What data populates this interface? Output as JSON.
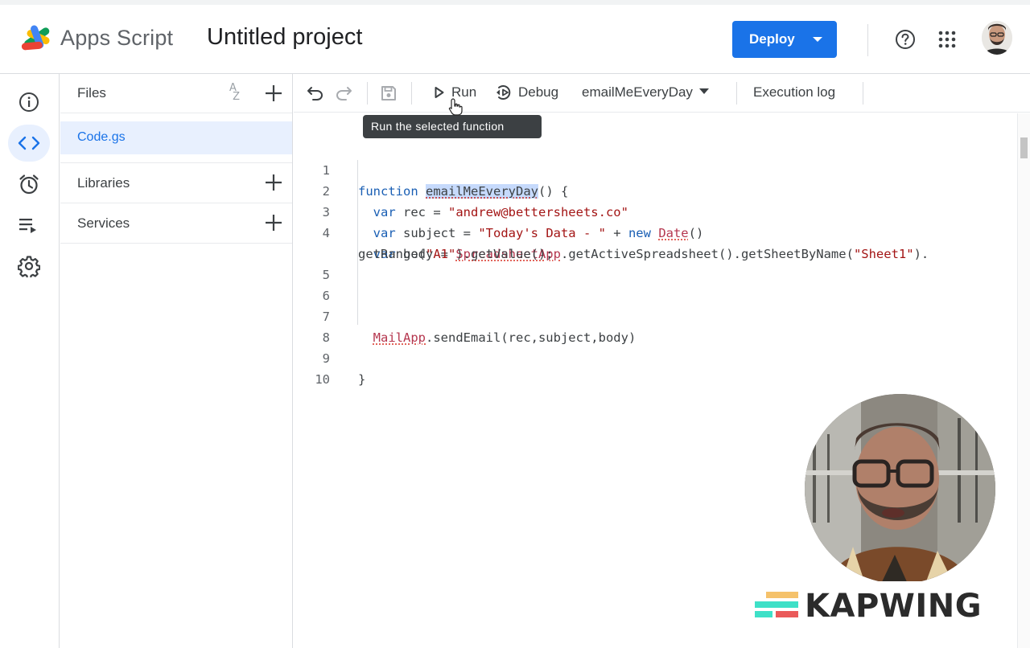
{
  "header": {
    "app_name": "Apps Script",
    "project_title": "Untitled project",
    "deploy_label": "Deploy"
  },
  "rail": {
    "items": [
      "overview",
      "editor",
      "triggers",
      "executions",
      "settings"
    ],
    "active": "editor"
  },
  "files": {
    "title": "Files",
    "items": [
      {
        "name": "Code.gs",
        "selected": true
      }
    ],
    "libraries_label": "Libraries",
    "services_label": "Services"
  },
  "toolbar": {
    "run_label": "Run",
    "debug_label": "Debug",
    "function_name": "emailMeEveryDay",
    "execution_log_label": "Execution log",
    "tooltip": "Run the selected function"
  },
  "editor": {
    "line_numbers": [
      "1",
      "2",
      "3",
      "4",
      "5",
      "6",
      "7",
      "8",
      "9",
      "10"
    ],
    "lines": [
      "function emailMeEveryDay() {",
      "  var rec = \"andrew@bettersheets.co\"",
      "  var subject = \"Today's Data - \" + new Date()",
      "  var body = SpreadsheetApp.getActiveSpreadsheet().getSheetByName(\"Sheet1\").",
      "getRange(\"A1\").getValue();",
      "",
      "",
      "  MailApp.sendEmail(rec,subject,body)",
      "",
      "}",
      ""
    ]
  },
  "overlay": {
    "brand": "KAPWING"
  },
  "colors": {
    "accent": "#1a73e8",
    "keyword": "#1a5fb4",
    "string": "#a31515",
    "kapwing_teal": "#3ee0c7",
    "kapwing_orange": "#f5c26b",
    "kapwing_red": "#ea5a5a"
  }
}
